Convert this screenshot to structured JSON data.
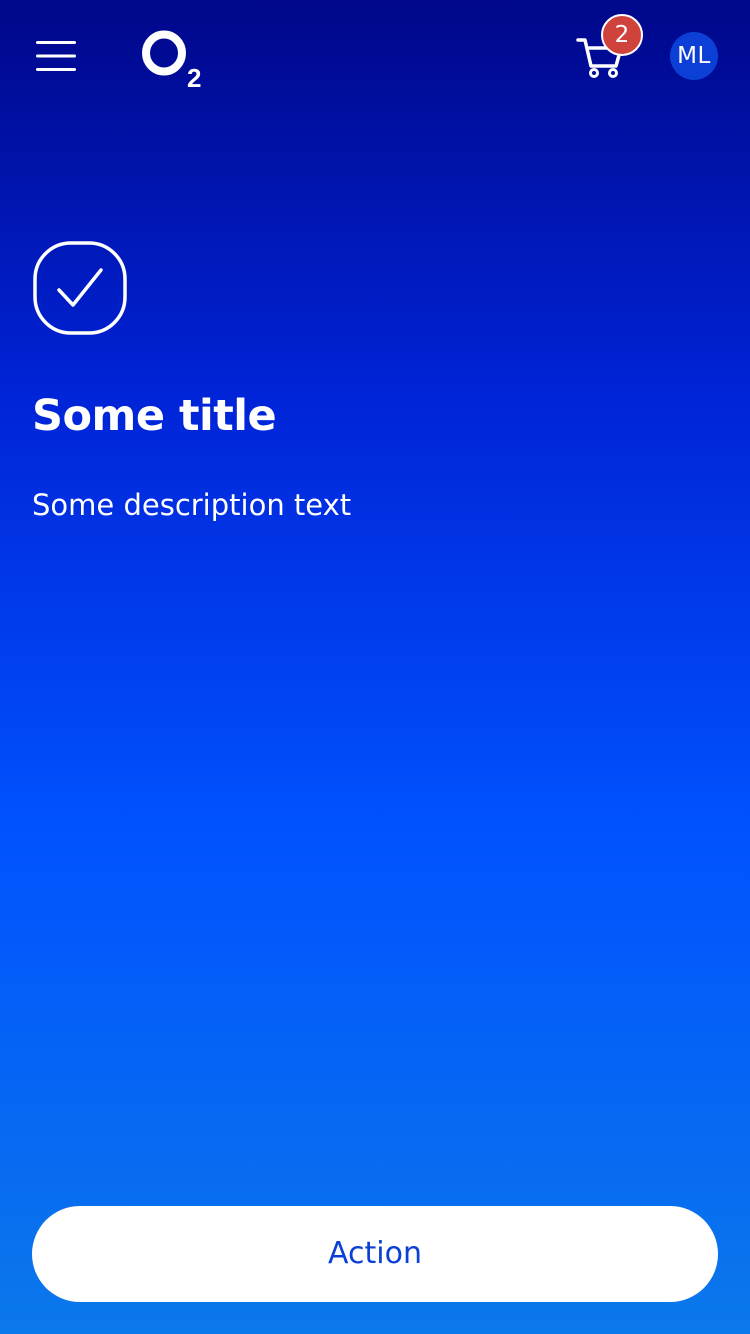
{
  "header": {
    "logo_text": "O2",
    "cart_count": "2",
    "avatar_initials": "ML",
    "icons": {
      "menu": "hamburger-menu-icon",
      "cart": "shopping-cart-icon"
    }
  },
  "main": {
    "status_icon": "check-icon",
    "title": "Some title",
    "description": "Some description text"
  },
  "footer": {
    "action_label": "Action"
  },
  "colors": {
    "gradient_top": "#00078a",
    "gradient_mid": "#0052ff",
    "gradient_bottom": "#0b78ea",
    "badge": "#d0423c",
    "button_text": "#0b3fd6",
    "avatar_bg": "#0b3fd6"
  }
}
